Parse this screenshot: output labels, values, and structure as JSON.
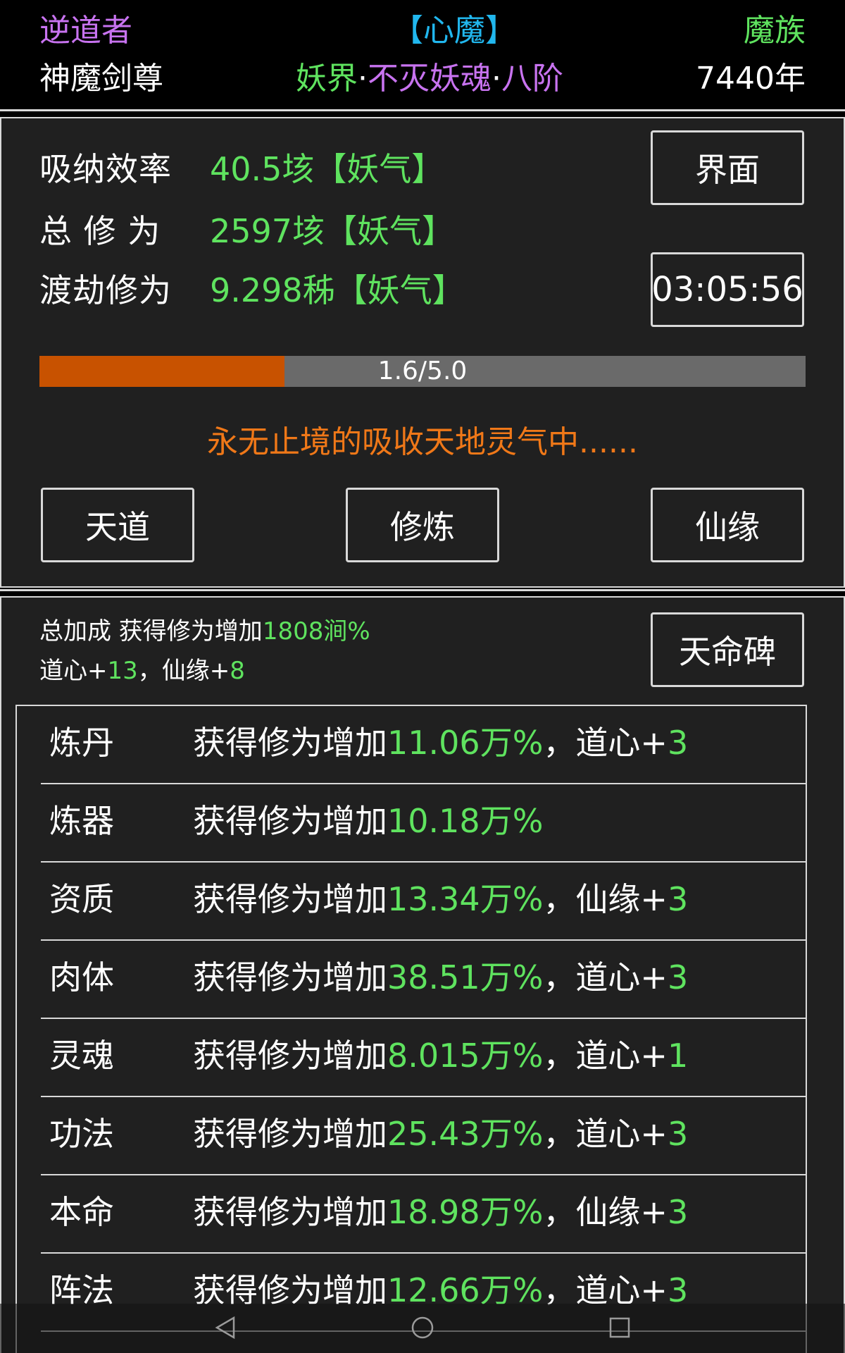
{
  "header": {
    "left_top": "逆道者",
    "left_bottom": "神魔剑尊",
    "center_top": "【心魔】",
    "realm": "妖界",
    "dot": "·",
    "body_type": "不灭妖魂",
    "stage": "八阶",
    "right_top": "魔族",
    "right_bottom": "7440年"
  },
  "stats": [
    {
      "label": "吸纳效率",
      "value": "40.5垓【妖气】"
    },
    {
      "label": "总 修 为",
      "value": "2597垓【妖气】"
    },
    {
      "label": "渡劫修为",
      "value": "9.298秭【妖气】"
    }
  ],
  "buttons": {
    "interface": "界面",
    "timer": "03:05:56",
    "tiandao": "天道",
    "xiulian": "修炼",
    "xianyuan": "仙缘",
    "tianmingbei": "天命碑"
  },
  "progress": {
    "text": "1.6/5.0",
    "fraction": 0.32
  },
  "status": "永无止境的吸收天地灵气中......",
  "bonus": {
    "line1_prefix": "总加成 获得修为增加",
    "line1_value": "1808涧%",
    "line2_a": "道心+",
    "line2_a_val": "13",
    "line2_sep": "，仙缘+",
    "line2_b_val": "8"
  },
  "rows": [
    {
      "cat": "炼丹",
      "prefix": "获得修为增加",
      "value": "11.06万%",
      "extra_label": "，道心+",
      "extra_val": "3"
    },
    {
      "cat": "炼器",
      "prefix": "获得修为增加",
      "value": "10.18万%",
      "extra_label": "",
      "extra_val": ""
    },
    {
      "cat": "资质",
      "prefix": "获得修为增加",
      "value": "13.34万%",
      "extra_label": "，仙缘+",
      "extra_val": "3"
    },
    {
      "cat": "肉体",
      "prefix": "获得修为增加",
      "value": "38.51万%",
      "extra_label": "，道心+",
      "extra_val": "3"
    },
    {
      "cat": "灵魂",
      "prefix": "获得修为增加",
      "value": "8.015万%",
      "extra_label": "，道心+",
      "extra_val": "1"
    },
    {
      "cat": "功法",
      "prefix": "获得修为增加",
      "value": "25.43万%",
      "extra_label": "，道心+",
      "extra_val": "3"
    },
    {
      "cat": "本命",
      "prefix": "获得修为增加",
      "value": "18.98万%",
      "extra_label": "，仙缘+",
      "extra_val": "3"
    },
    {
      "cat": "阵法",
      "prefix": "获得修为增加",
      "value": "12.66万%",
      "extra_label": "，道心+",
      "extra_val": "3"
    }
  ],
  "colors": {
    "purple": "#c873f0",
    "cyan": "#21b7ee",
    "green": "#5fe35f",
    "orange": "#f07818",
    "progress_fill": "#c85200",
    "panel_bg": "#202020"
  },
  "nav": {
    "back": "back-triangle-icon",
    "home": "home-circle-icon",
    "recent": "recent-square-icon"
  }
}
